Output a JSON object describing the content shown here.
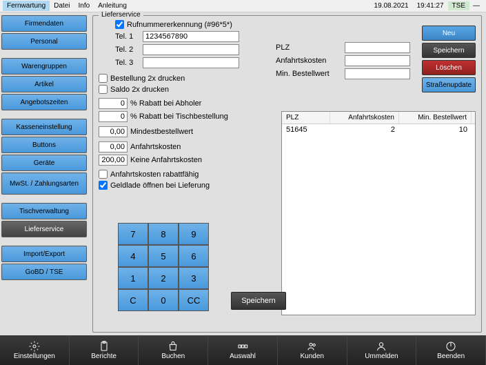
{
  "menubar": {
    "items": [
      "Fernwartung",
      "Datei",
      "Info",
      "Anleitung"
    ],
    "date": "19.08.2021",
    "time": "19:41:27",
    "tse": "TSE"
  },
  "sidebar": {
    "items": [
      "Firmendaten",
      "Personal",
      "Warengruppen",
      "Artikel",
      "Angebotszeiten",
      "Kasseneinstellung",
      "Buttons",
      "Geräte",
      "MwSt. / Zahlungsarten",
      "Tischverwaltung",
      "Lieferservice",
      "Import/Export",
      "GoBD / TSE"
    ]
  },
  "legend": "Lieferservice",
  "checkboxes": {
    "rufnummer": "Rufnummererkennung (#96*5*)",
    "bestellung2x": "Bestellung 2x drucken",
    "saldo2x": "Saldo 2x drucken",
    "rabattfaehig": "Anfahrtskosten rabattfähig",
    "geldlade": "Geldlade öffnen bei Lieferung"
  },
  "tel": {
    "label1": "Tel. 1",
    "val1": "1234567890",
    "label2": "Tel. 2",
    "val2": "",
    "label3": "Tel. 3",
    "val3": ""
  },
  "fields": {
    "rabatt_abholer_val": "0",
    "rabatt_abholer_lbl": "% Rabatt bei Abholer",
    "rabatt_tisch_val": "0",
    "rabatt_tisch_lbl": "% Rabatt bei Tischbestellung",
    "mindest_val": "0,00",
    "mindest_lbl": "Mindestbestellwert",
    "anfahrt_val": "0,00",
    "anfahrt_lbl": "Anfahrtskosten",
    "keine_val": "200,00",
    "keine_lbl": "Keine Anfahrtskosten"
  },
  "rightfields": {
    "plz_lbl": "PLZ",
    "plz_val": "",
    "anfahrt_lbl": "Anfahrtskosten",
    "anfahrt_val": "",
    "minbest_lbl": "Min. Bestellwert",
    "minbest_val": ""
  },
  "actions": {
    "neu": "Neu",
    "speichern": "Speichern",
    "loeschen": "Löschen",
    "strasse": "Straßenupdate"
  },
  "table": {
    "headers": [
      "PLZ",
      "Anfahrtskosten",
      "Min. Bestellwert"
    ],
    "rows": [
      [
        "51645",
        "2",
        "10"
      ]
    ]
  },
  "keypad": [
    [
      "7",
      "8",
      "9"
    ],
    [
      "4",
      "5",
      "6"
    ],
    [
      "1",
      "2",
      "3"
    ],
    [
      "C",
      "0",
      "CC"
    ]
  ],
  "save": "Speichern",
  "bottombar": [
    "Einstellungen",
    "Berichte",
    "Buchen",
    "Auswahl",
    "Kunden",
    "Ummelden",
    "Beenden"
  ]
}
